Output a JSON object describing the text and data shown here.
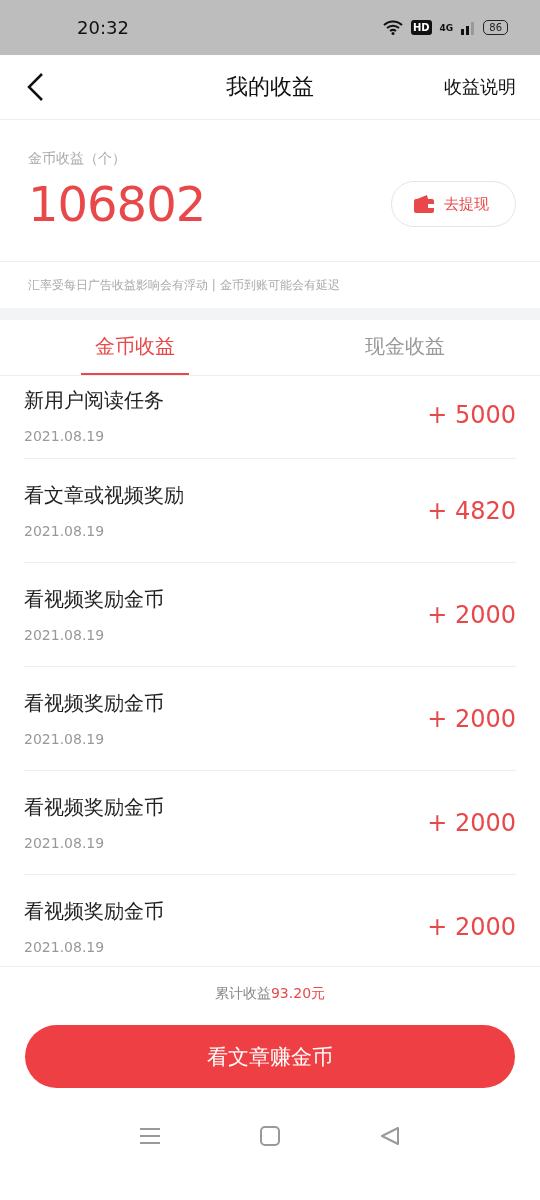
{
  "status_bar": {
    "time": "20:32",
    "network_badge": "HD",
    "network_type": "4G",
    "battery": "86"
  },
  "header": {
    "title": "我的收益",
    "action": "收益说明"
  },
  "summary": {
    "label": "金币收益（个）",
    "amount": "106802",
    "withdraw_button": "去提现",
    "note": "汇率受每日广告收益影响会有浮动 | 金币到账可能会有延迟"
  },
  "tabs": [
    {
      "label": "金币收益",
      "selected": true
    },
    {
      "label": "现金收益",
      "selected": false
    }
  ],
  "records": [
    {
      "title": "新用户阅读任务",
      "date": "2021.08.19",
      "amount": "+ 5000"
    },
    {
      "title": "看文章或视频奖励",
      "date": "2021.08.19",
      "amount": "+ 4820"
    },
    {
      "title": "看视频奖励金币",
      "date": "2021.08.19",
      "amount": "+ 2000"
    },
    {
      "title": "看视频奖励金币",
      "date": "2021.08.19",
      "amount": "+ 2000"
    },
    {
      "title": "看视频奖励金币",
      "date": "2021.08.19",
      "amount": "+ 2000"
    },
    {
      "title": "看视频奖励金币",
      "date": "2021.08.19",
      "amount": "+ 2000"
    }
  ],
  "footer": {
    "total_label": "累计收益",
    "total_value": "93.20元",
    "button": "看文章赚金币"
  }
}
